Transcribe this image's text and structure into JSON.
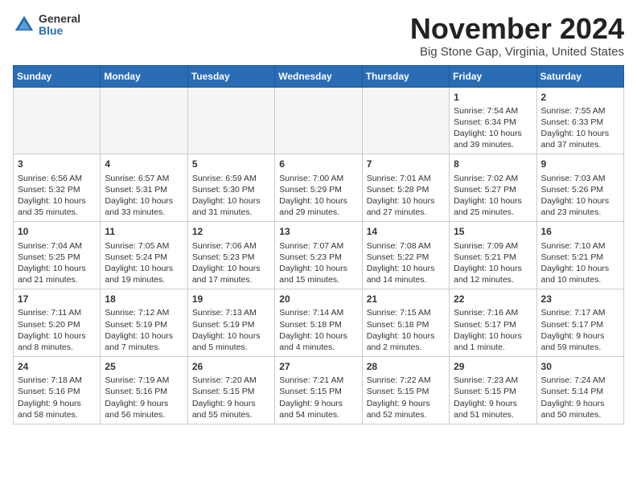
{
  "logo": {
    "general": "General",
    "blue": "Blue"
  },
  "title": "November 2024",
  "location": "Big Stone Gap, Virginia, United States",
  "weekdays": [
    "Sunday",
    "Monday",
    "Tuesday",
    "Wednesday",
    "Thursday",
    "Friday",
    "Saturday"
  ],
  "weeks": [
    [
      {
        "day": "",
        "info": ""
      },
      {
        "day": "",
        "info": ""
      },
      {
        "day": "",
        "info": ""
      },
      {
        "day": "",
        "info": ""
      },
      {
        "day": "",
        "info": ""
      },
      {
        "day": "1",
        "info": "Sunrise: 7:54 AM\nSunset: 6:34 PM\nDaylight: 10 hours and 39 minutes."
      },
      {
        "day": "2",
        "info": "Sunrise: 7:55 AM\nSunset: 6:33 PM\nDaylight: 10 hours and 37 minutes."
      }
    ],
    [
      {
        "day": "3",
        "info": "Sunrise: 6:56 AM\nSunset: 5:32 PM\nDaylight: 10 hours and 35 minutes."
      },
      {
        "day": "4",
        "info": "Sunrise: 6:57 AM\nSunset: 5:31 PM\nDaylight: 10 hours and 33 minutes."
      },
      {
        "day": "5",
        "info": "Sunrise: 6:59 AM\nSunset: 5:30 PM\nDaylight: 10 hours and 31 minutes."
      },
      {
        "day": "6",
        "info": "Sunrise: 7:00 AM\nSunset: 5:29 PM\nDaylight: 10 hours and 29 minutes."
      },
      {
        "day": "7",
        "info": "Sunrise: 7:01 AM\nSunset: 5:28 PM\nDaylight: 10 hours and 27 minutes."
      },
      {
        "day": "8",
        "info": "Sunrise: 7:02 AM\nSunset: 5:27 PM\nDaylight: 10 hours and 25 minutes."
      },
      {
        "day": "9",
        "info": "Sunrise: 7:03 AM\nSunset: 5:26 PM\nDaylight: 10 hours and 23 minutes."
      }
    ],
    [
      {
        "day": "10",
        "info": "Sunrise: 7:04 AM\nSunset: 5:25 PM\nDaylight: 10 hours and 21 minutes."
      },
      {
        "day": "11",
        "info": "Sunrise: 7:05 AM\nSunset: 5:24 PM\nDaylight: 10 hours and 19 minutes."
      },
      {
        "day": "12",
        "info": "Sunrise: 7:06 AM\nSunset: 5:23 PM\nDaylight: 10 hours and 17 minutes."
      },
      {
        "day": "13",
        "info": "Sunrise: 7:07 AM\nSunset: 5:23 PM\nDaylight: 10 hours and 15 minutes."
      },
      {
        "day": "14",
        "info": "Sunrise: 7:08 AM\nSunset: 5:22 PM\nDaylight: 10 hours and 14 minutes."
      },
      {
        "day": "15",
        "info": "Sunrise: 7:09 AM\nSunset: 5:21 PM\nDaylight: 10 hours and 12 minutes."
      },
      {
        "day": "16",
        "info": "Sunrise: 7:10 AM\nSunset: 5:21 PM\nDaylight: 10 hours and 10 minutes."
      }
    ],
    [
      {
        "day": "17",
        "info": "Sunrise: 7:11 AM\nSunset: 5:20 PM\nDaylight: 10 hours and 8 minutes."
      },
      {
        "day": "18",
        "info": "Sunrise: 7:12 AM\nSunset: 5:19 PM\nDaylight: 10 hours and 7 minutes."
      },
      {
        "day": "19",
        "info": "Sunrise: 7:13 AM\nSunset: 5:19 PM\nDaylight: 10 hours and 5 minutes."
      },
      {
        "day": "20",
        "info": "Sunrise: 7:14 AM\nSunset: 5:18 PM\nDaylight: 10 hours and 4 minutes."
      },
      {
        "day": "21",
        "info": "Sunrise: 7:15 AM\nSunset: 5:18 PM\nDaylight: 10 hours and 2 minutes."
      },
      {
        "day": "22",
        "info": "Sunrise: 7:16 AM\nSunset: 5:17 PM\nDaylight: 10 hours and 1 minute."
      },
      {
        "day": "23",
        "info": "Sunrise: 7:17 AM\nSunset: 5:17 PM\nDaylight: 9 hours and 59 minutes."
      }
    ],
    [
      {
        "day": "24",
        "info": "Sunrise: 7:18 AM\nSunset: 5:16 PM\nDaylight: 9 hours and 58 minutes."
      },
      {
        "day": "25",
        "info": "Sunrise: 7:19 AM\nSunset: 5:16 PM\nDaylight: 9 hours and 56 minutes."
      },
      {
        "day": "26",
        "info": "Sunrise: 7:20 AM\nSunset: 5:15 PM\nDaylight: 9 hours and 55 minutes."
      },
      {
        "day": "27",
        "info": "Sunrise: 7:21 AM\nSunset: 5:15 PM\nDaylight: 9 hours and 54 minutes."
      },
      {
        "day": "28",
        "info": "Sunrise: 7:22 AM\nSunset: 5:15 PM\nDaylight: 9 hours and 52 minutes."
      },
      {
        "day": "29",
        "info": "Sunrise: 7:23 AM\nSunset: 5:15 PM\nDaylight: 9 hours and 51 minutes."
      },
      {
        "day": "30",
        "info": "Sunrise: 7:24 AM\nSunset: 5:14 PM\nDaylight: 9 hours and 50 minutes."
      }
    ]
  ]
}
